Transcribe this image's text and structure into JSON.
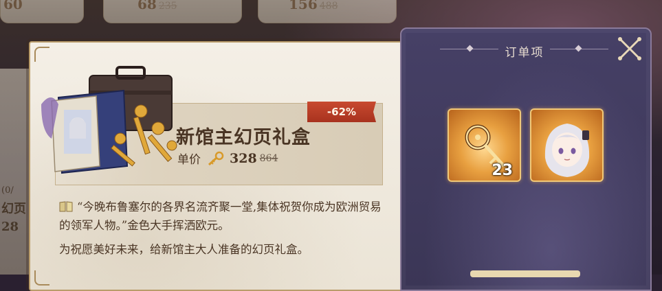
{
  "background": {
    "top_prices": [
      {
        "current": "68",
        "original": "235"
      },
      {
        "current": "156",
        "original": "488"
      }
    ],
    "left_fragments": [
      "0/",
      "幻页",
      "28"
    ],
    "left_small": "(0/",
    "left_top": "60"
  },
  "product": {
    "name": "新馆主幻页礼盒",
    "price_label": "单价",
    "price": "328",
    "original_price": "864",
    "discount": "-62%",
    "quote": "“今晚布鲁塞尔的各界名流齐聚一堂,集体祝贺你成为欧洲贸易的领军人物。”金色大手挥洒欧元。",
    "description": "为祝愿美好未来，给新馆主大人准备的幻页礼盒。"
  },
  "order_panel": {
    "title": "订单项",
    "items": [
      {
        "icon": "golden-key-icon",
        "count": "23"
      },
      {
        "icon": "character-portrait-icon",
        "count": ""
      }
    ]
  },
  "colors": {
    "accent_gold": "#e8a040",
    "discount_red": "#c84a30",
    "panel_purple": "#464066",
    "text_brown": "#4a3524"
  }
}
